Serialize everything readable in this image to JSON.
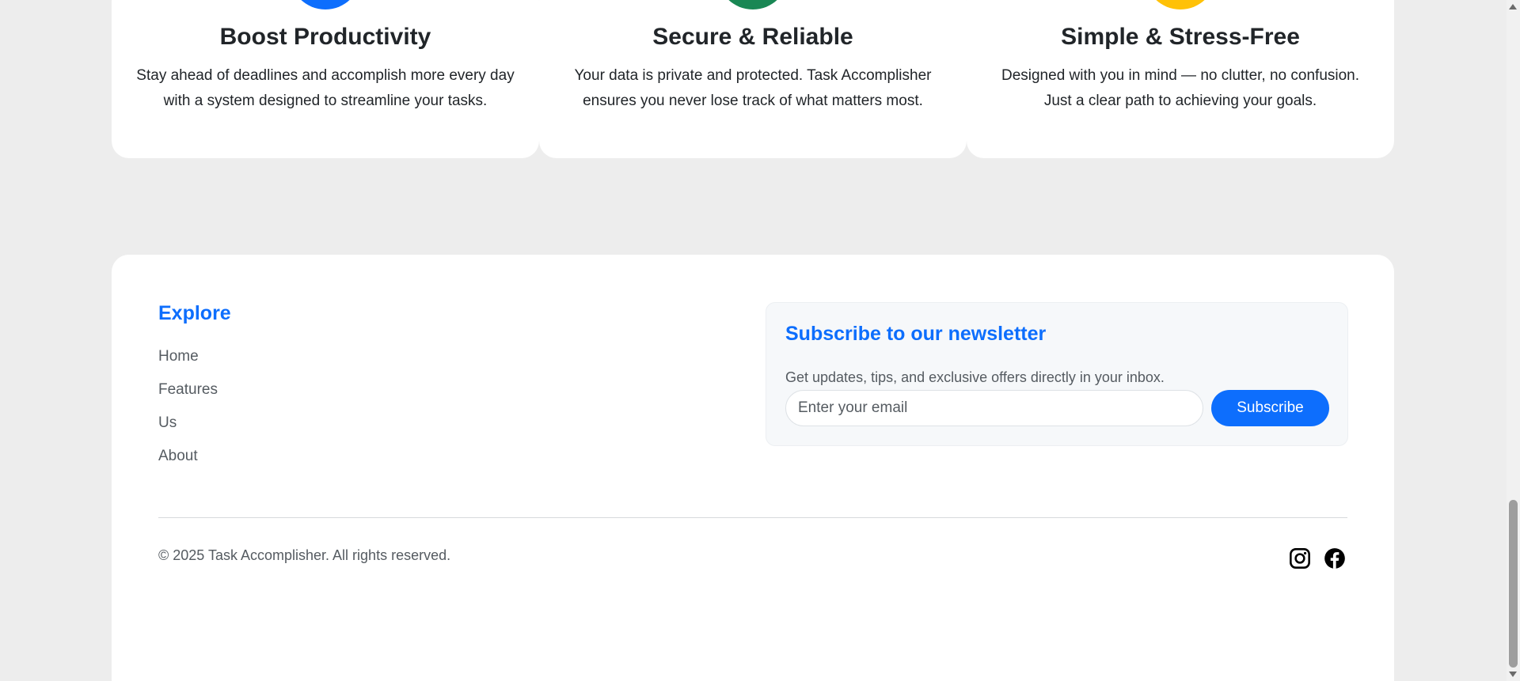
{
  "features": [
    {
      "title": "Boost Productivity",
      "description": "Stay ahead of deadlines and accomplish more every day with a system designed to streamline your tasks.",
      "color": "#0d6efd"
    },
    {
      "title": "Secure & Reliable",
      "description": "Your data is private and protected. Task Accomplisher ensures you never lose track of what matters most.",
      "color": "#198754"
    },
    {
      "title": "Simple & Stress-Free",
      "description": "Designed with you in mind — no clutter, no confusion. Just a clear path to achieving your goals.",
      "color": "#ffc107"
    }
  ],
  "footer": {
    "explore_title": "Explore",
    "links": [
      "Home",
      "Features",
      "Us",
      "About"
    ],
    "newsletter": {
      "title": "Subscribe to our newsletter",
      "description": "Get updates, tips, and exclusive offers directly in your inbox.",
      "email_placeholder": "Enter your email",
      "email_value": "",
      "button_label": "Subscribe"
    },
    "copyright": "© 2025 Task Accomplisher. All rights reserved.",
    "social": [
      {
        "icon": "instagram-icon"
      },
      {
        "icon": "facebook-icon"
      }
    ]
  },
  "colors": {
    "accent": "#0d6efd",
    "page_background": "#ededed",
    "muted_text": "#555b61"
  }
}
